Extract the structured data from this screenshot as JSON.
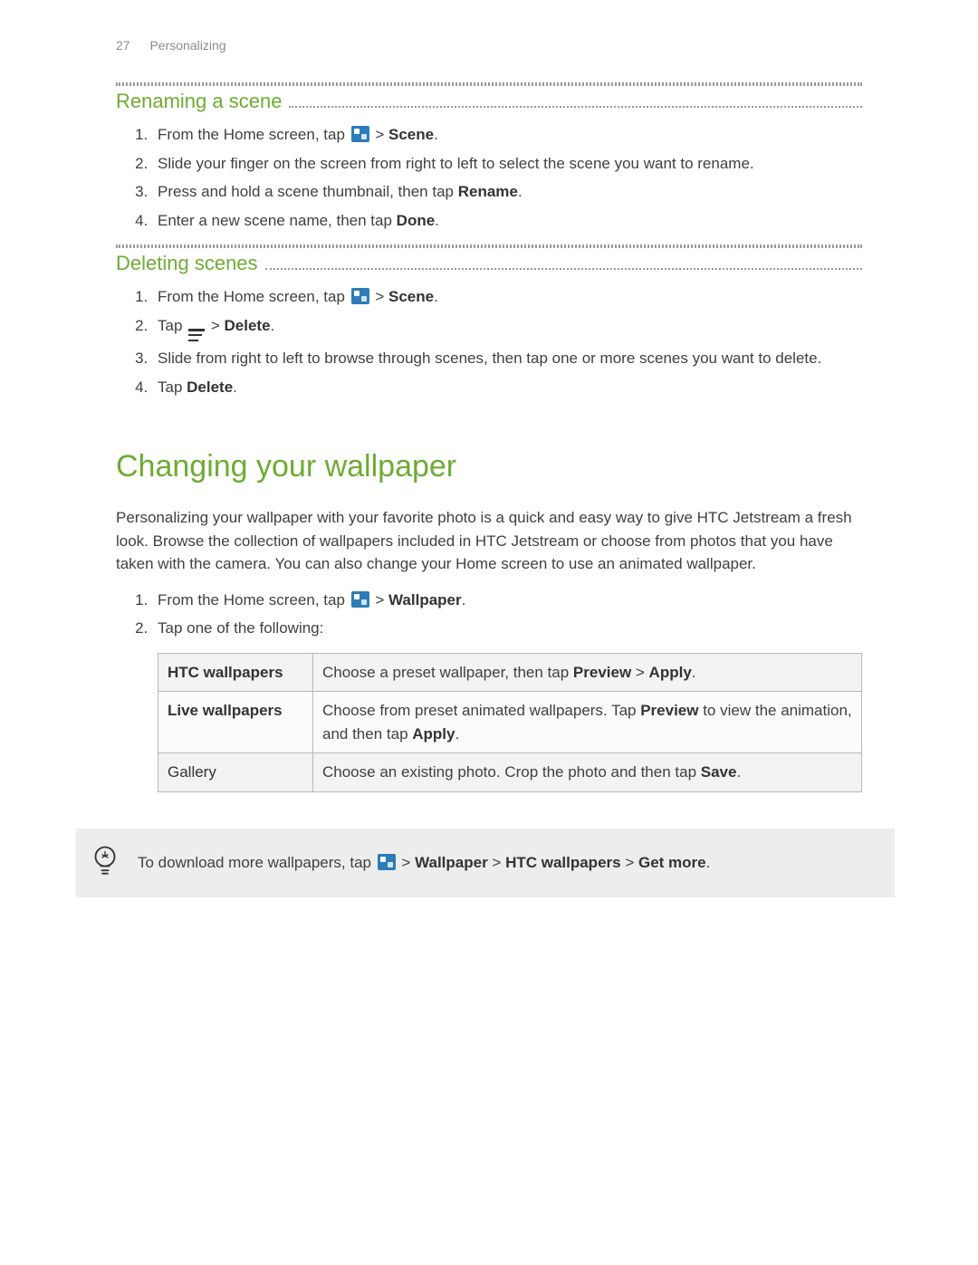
{
  "header": {
    "page_number": "27",
    "section": "Personalizing"
  },
  "section_renaming": {
    "title": "Renaming a scene",
    "step1_pre": "From the Home screen, tap ",
    "step1_sep": " > ",
    "step1_bold": "Scene",
    "step1_end": ".",
    "step2": "Slide your finger on the screen from right to left to select the scene you want to rename.",
    "step3_pre": "Press and hold a scene thumbnail, then tap ",
    "step3_bold": "Rename",
    "step3_end": ".",
    "step4_pre": "Enter a new scene name, then tap ",
    "step4_bold": "Done",
    "step4_end": "."
  },
  "section_deleting": {
    "title": "Deleting scenes",
    "step1_pre": "From the Home screen, tap ",
    "step1_sep": " > ",
    "step1_bold": "Scene",
    "step1_end": ".",
    "step2_pre": "Tap ",
    "step2_sep": " > ",
    "step2_bold": "Delete",
    "step2_end": ".",
    "step3": "Slide from right to left to browse through scenes, then tap one or more scenes you want to delete.",
    "step4_pre": "Tap ",
    "step4_bold": "Delete",
    "step4_end": "."
  },
  "section_wallpaper": {
    "title": "Changing your wallpaper",
    "intro": "Personalizing your wallpaper with your favorite photo is a quick and easy way to give HTC Jetstream a fresh look. Browse the collection of wallpapers included in HTC Jetstream or choose from photos that you have taken with the camera. You can also change your Home screen to use an animated wallpaper.",
    "step1_pre": "From the Home screen, tap ",
    "step1_sep": " > ",
    "step1_bold": "Wallpaper",
    "step1_end": ".",
    "step2": "Tap one of the following:",
    "table": {
      "r1c1": "HTC wallpapers",
      "r1c2_pre": "Choose a preset wallpaper, then tap ",
      "r1c2_b1": "Preview",
      "r1c2_sep": " > ",
      "r1c2_b2": "Apply",
      "r1c2_end": ".",
      "r2c1": "Live wallpapers",
      "r2c2_pre": "Choose from preset animated wallpapers. Tap ",
      "r2c2_b1": "Preview",
      "r2c2_mid": " to view the animation, and then tap ",
      "r2c2_b2": "Apply",
      "r2c2_end": ".",
      "r3c1": "Gallery",
      "r3c2_pre": "Choose an existing photo. Crop the photo and then tap ",
      "r3c2_b1": "Save",
      "r3c2_end": "."
    },
    "tip_pre": "To download more wallpapers, tap ",
    "tip_sep1": " > ",
    "tip_b1": "Wallpaper",
    "tip_sep2": " > ",
    "tip_b2": "HTC wallpapers",
    "tip_sep3": " > ",
    "tip_b3": "Get more",
    "tip_end": "."
  }
}
